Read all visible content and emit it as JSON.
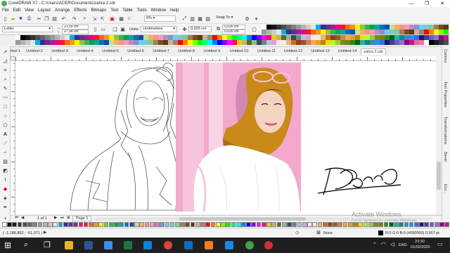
{
  "window": {
    "title": "CorelDRAW X7 - C:\\Users\\ACER\\Documents\\zahra 2.cdr",
    "minimize": "—",
    "maximize": "❐",
    "close": "✕"
  },
  "menu": [
    "File",
    "Edit",
    "View",
    "Layout",
    "Arrange",
    "Effects",
    "Bitmaps",
    "Text",
    "Table",
    "Tools",
    "Window",
    "Help"
  ],
  "standard_toolbar": {
    "zoom_value": "6%",
    "snap_to": "Snap To"
  },
  "property_bar": {
    "page_size": "Letter",
    "width": "21,59 cm",
    "height": "27,94 cm",
    "units_label": "Units:",
    "units_value": "centimeters",
    "nudge": "0,025 cm",
    "dup_x": "0,635 cm",
    "dup_y": "0,635 cm"
  },
  "document_tabs": [
    "Untitled-1",
    "Untitled-2",
    "Untitled-3",
    "Untitled-4",
    "Untitled-5",
    "Untitled-6",
    "Untitled-7",
    "Untitled-8",
    "Untitled-9",
    "Untitled-10",
    "Untitled-11",
    "Untitled-12",
    "Untitled-13",
    "Untitled-14",
    "zahra 2.cdr"
  ],
  "active_tab": "zahra 2.cdr",
  "dockers": [
    "Contour",
    "Text Properties",
    "Transformations",
    "Bevel",
    "Env..."
  ],
  "page_nav": {
    "page_count": "1 of 1",
    "page_tab": "Page 1"
  },
  "status": {
    "coords": "( -1.186,852 ; -51,071 )",
    "fill_none": "None",
    "outline": "R:0 G:0 B:0 (#000000)  0,567 pt"
  },
  "watermark": {
    "line1": "Activate Windows",
    "line2": "Go to Settings to activate Windows."
  },
  "taskbar": {
    "time": "23:30",
    "date": "01/02/2020",
    "lang": "ENG"
  },
  "colors": {
    "pink_bg": "#f4a8cc",
    "pink_light": "#f7c4dd",
    "hijab": "#c98a1a",
    "accent_blue": "#1e6fd0"
  },
  "palette_colors": [
    "#ffffff",
    "#000000",
    "#1a1a1a",
    "#333333",
    "#4d4d4d",
    "#666666",
    "#808080",
    "#999999",
    "#b3b3b3",
    "#cccccc",
    "#e6e6e6",
    "#00aeef",
    "#2e3192",
    "#662d91",
    "#92278f",
    "#ec008c",
    "#ed1c24",
    "#f26522",
    "#f7941d",
    "#fff200",
    "#8dc63f",
    "#39b54a",
    "#00a651",
    "#00a99d",
    "#0072bc",
    "#0054a6",
    "#c4df9b",
    "#fbaf5d",
    "#f69679",
    "#f49ac1",
    "#bd8cbf",
    "#8393ca",
    "#6dcff6",
    "#7accc8",
    "#82ca9c",
    "#a67c52",
    "#754c24",
    "#603913",
    "#c7b299",
    "#998675",
    "#ff0000",
    "#ff7f00",
    "#ffff00",
    "#7fff00",
    "#00ff00",
    "#00ff7f",
    "#00ffff",
    "#007fff",
    "#0000ff",
    "#7f00ff",
    "#ff00ff",
    "#ff007f",
    "#e4d00a",
    "#bdb76b",
    "#556b2f",
    "#8fbc8f",
    "#2f4f4f",
    "#708090",
    "#b0c4de",
    "#dda0dd",
    "#ffe4e1",
    "#faebd7",
    "#deb887",
    "#d2691e",
    "#8b4513",
    "#a0522d",
    "#cd853f",
    "#f4a460",
    "#daa520",
    "#b8860b",
    "#ffd700",
    "#adff2f",
    "#9acd32",
    "#6b8e23",
    "#808000",
    "#228b22",
    "#006400",
    "#20b2aa",
    "#008b8b",
    "#4682b4",
    "#1e90ff",
    "#4169e1",
    "#191970",
    "#483d8b",
    "#6a5acd",
    "#9370db",
    "#8b008b",
    "#c71585",
    "#db7093",
    "#ff69b4"
  ]
}
